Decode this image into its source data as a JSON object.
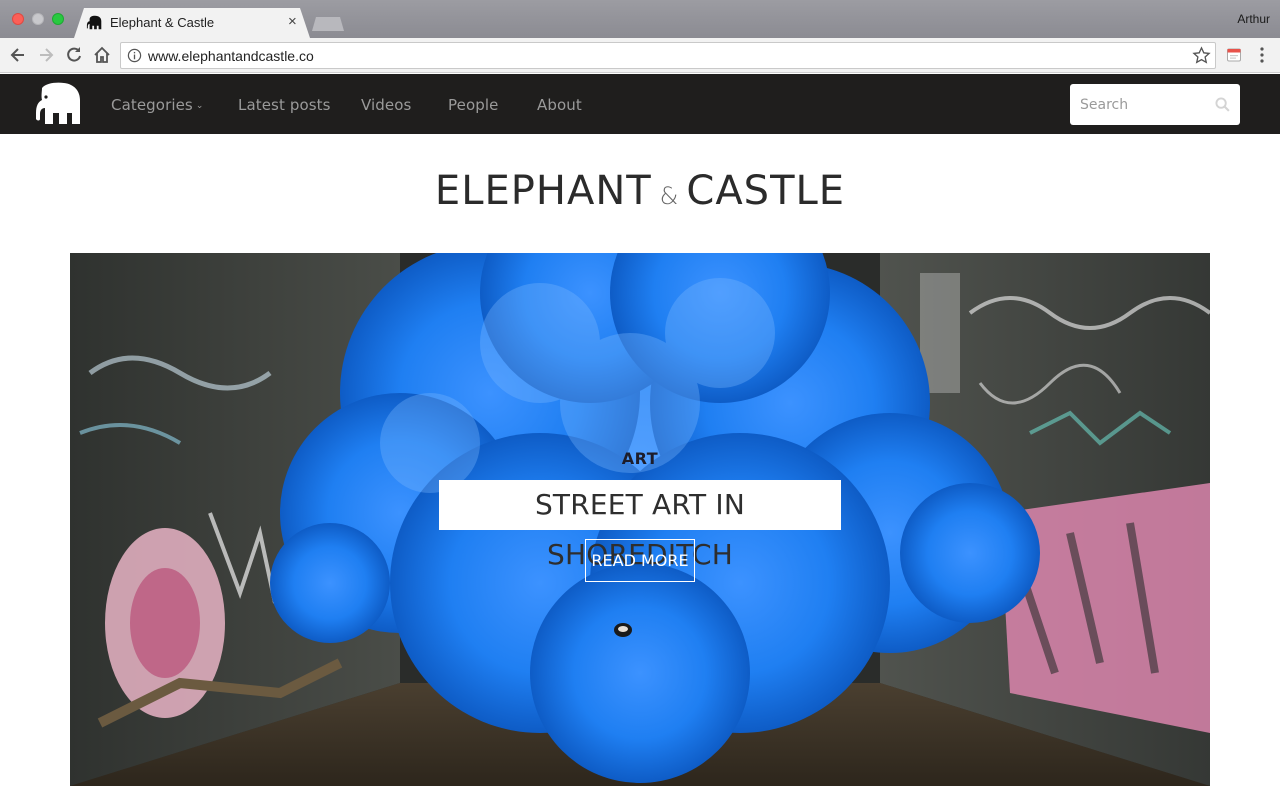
{
  "browser": {
    "tab_title": "Elephant & Castle",
    "tab_close": "×",
    "profile_name": "Arthur",
    "url": "www.elephantandcastle.co"
  },
  "site_nav": {
    "items": [
      {
        "label": "Categories",
        "has_dropdown": true
      },
      {
        "label": "Latest posts"
      },
      {
        "label": "Videos"
      },
      {
        "label": "People"
      },
      {
        "label": "About"
      }
    ],
    "caret": "⌄",
    "search_placeholder": "Search"
  },
  "masthead": {
    "word1": "ELEPHANT",
    "amp": "&",
    "word2": "CASTLE"
  },
  "hero": {
    "category": "ART",
    "title": "STREET ART IN SHOREDITCH",
    "button_label": "READ MORE"
  },
  "colors": {
    "nav_bg": "#1f1e1d",
    "smoke_blue": "#1f7ff2",
    "nav_text": "#9a9a9a"
  }
}
